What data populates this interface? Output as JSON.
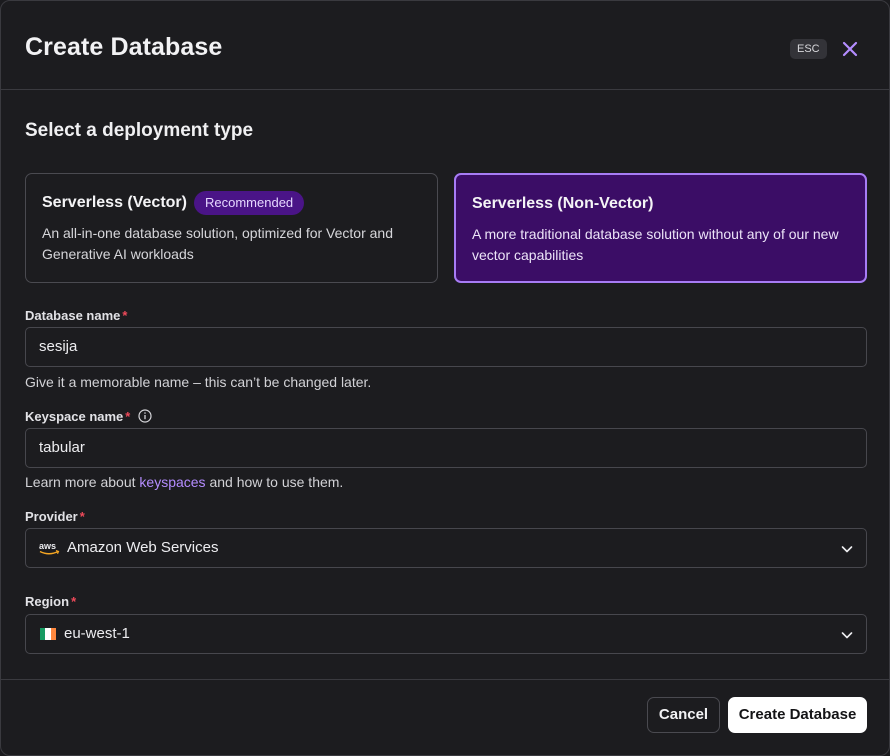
{
  "dialog": {
    "title": "Create Database",
    "esc_label": "ESC"
  },
  "deployment": {
    "heading": "Select a deployment type",
    "options": [
      {
        "title": "Serverless (Vector)",
        "badge": "Recommended",
        "description": "An all-in-one database solution, optimized for Vector and Generative AI workloads",
        "selected": false
      },
      {
        "title": "Serverless (Non-Vector)",
        "description": "A more traditional database solution without any of our new vector capabilities",
        "selected": true
      }
    ]
  },
  "database_name": {
    "label": "Database name",
    "required_mark": "*",
    "value": "sesija",
    "help": "Give it a memorable name – this can’t be changed later."
  },
  "keyspace_name": {
    "label": "Keyspace name",
    "required_mark": "*",
    "value": "tabular",
    "help_prefix": "Learn more about ",
    "help_link": "keyspaces",
    "help_suffix": " and how to use them."
  },
  "provider": {
    "label": "Provider",
    "required_mark": "*",
    "value": "Amazon Web Services",
    "icon": "aws-logo-icon"
  },
  "region": {
    "label": "Region",
    "required_mark": "*",
    "value": "eu-west-1",
    "icon": "ireland-flag-icon"
  },
  "footer": {
    "cancel_label": "Cancel",
    "create_label": "Create Database"
  },
  "colors": {
    "accent": "#a77cf5",
    "selected_card_bg": "#3b0d66",
    "required": "#ef4a5a",
    "link": "#b48cff"
  }
}
